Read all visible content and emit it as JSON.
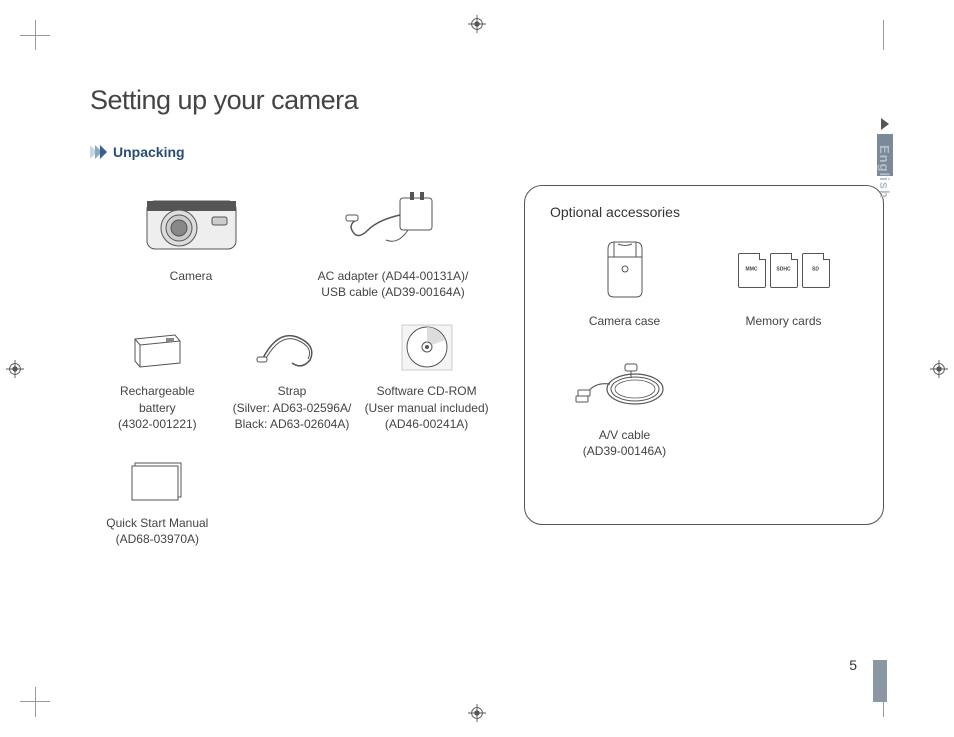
{
  "title": "Setting up your camera",
  "section": "Unpacking",
  "side_label": "English",
  "page_number": "5",
  "items": {
    "camera": {
      "label": "Camera"
    },
    "adapter": {
      "label1": "AC adapter (AD44-00131A)/",
      "label2": "USB cable (AD39-00164A)"
    },
    "battery": {
      "label1": "Rechargeable",
      "label2": "battery",
      "label3": "(4302-001221)"
    },
    "strap": {
      "label1": "Strap",
      "label2": "(Silver: AD63-02596A/",
      "label3": "Black: AD63-02604A)"
    },
    "cdrom": {
      "label1": "Software CD-ROM",
      "label2": "(User manual included)",
      "label3": "(AD46-00241A)"
    },
    "manual": {
      "label1": "Quick Start Manual",
      "label2": "(AD68-03970A)"
    }
  },
  "optional": {
    "title": "Optional accessories",
    "case": {
      "label": "Camera case"
    },
    "memory": {
      "label": "Memory cards",
      "c1": "MMC",
      "c2": "SDHC",
      "c3": "SD"
    },
    "av": {
      "label1": "A/V cable",
      "label2": "(AD39-00146A)"
    }
  }
}
